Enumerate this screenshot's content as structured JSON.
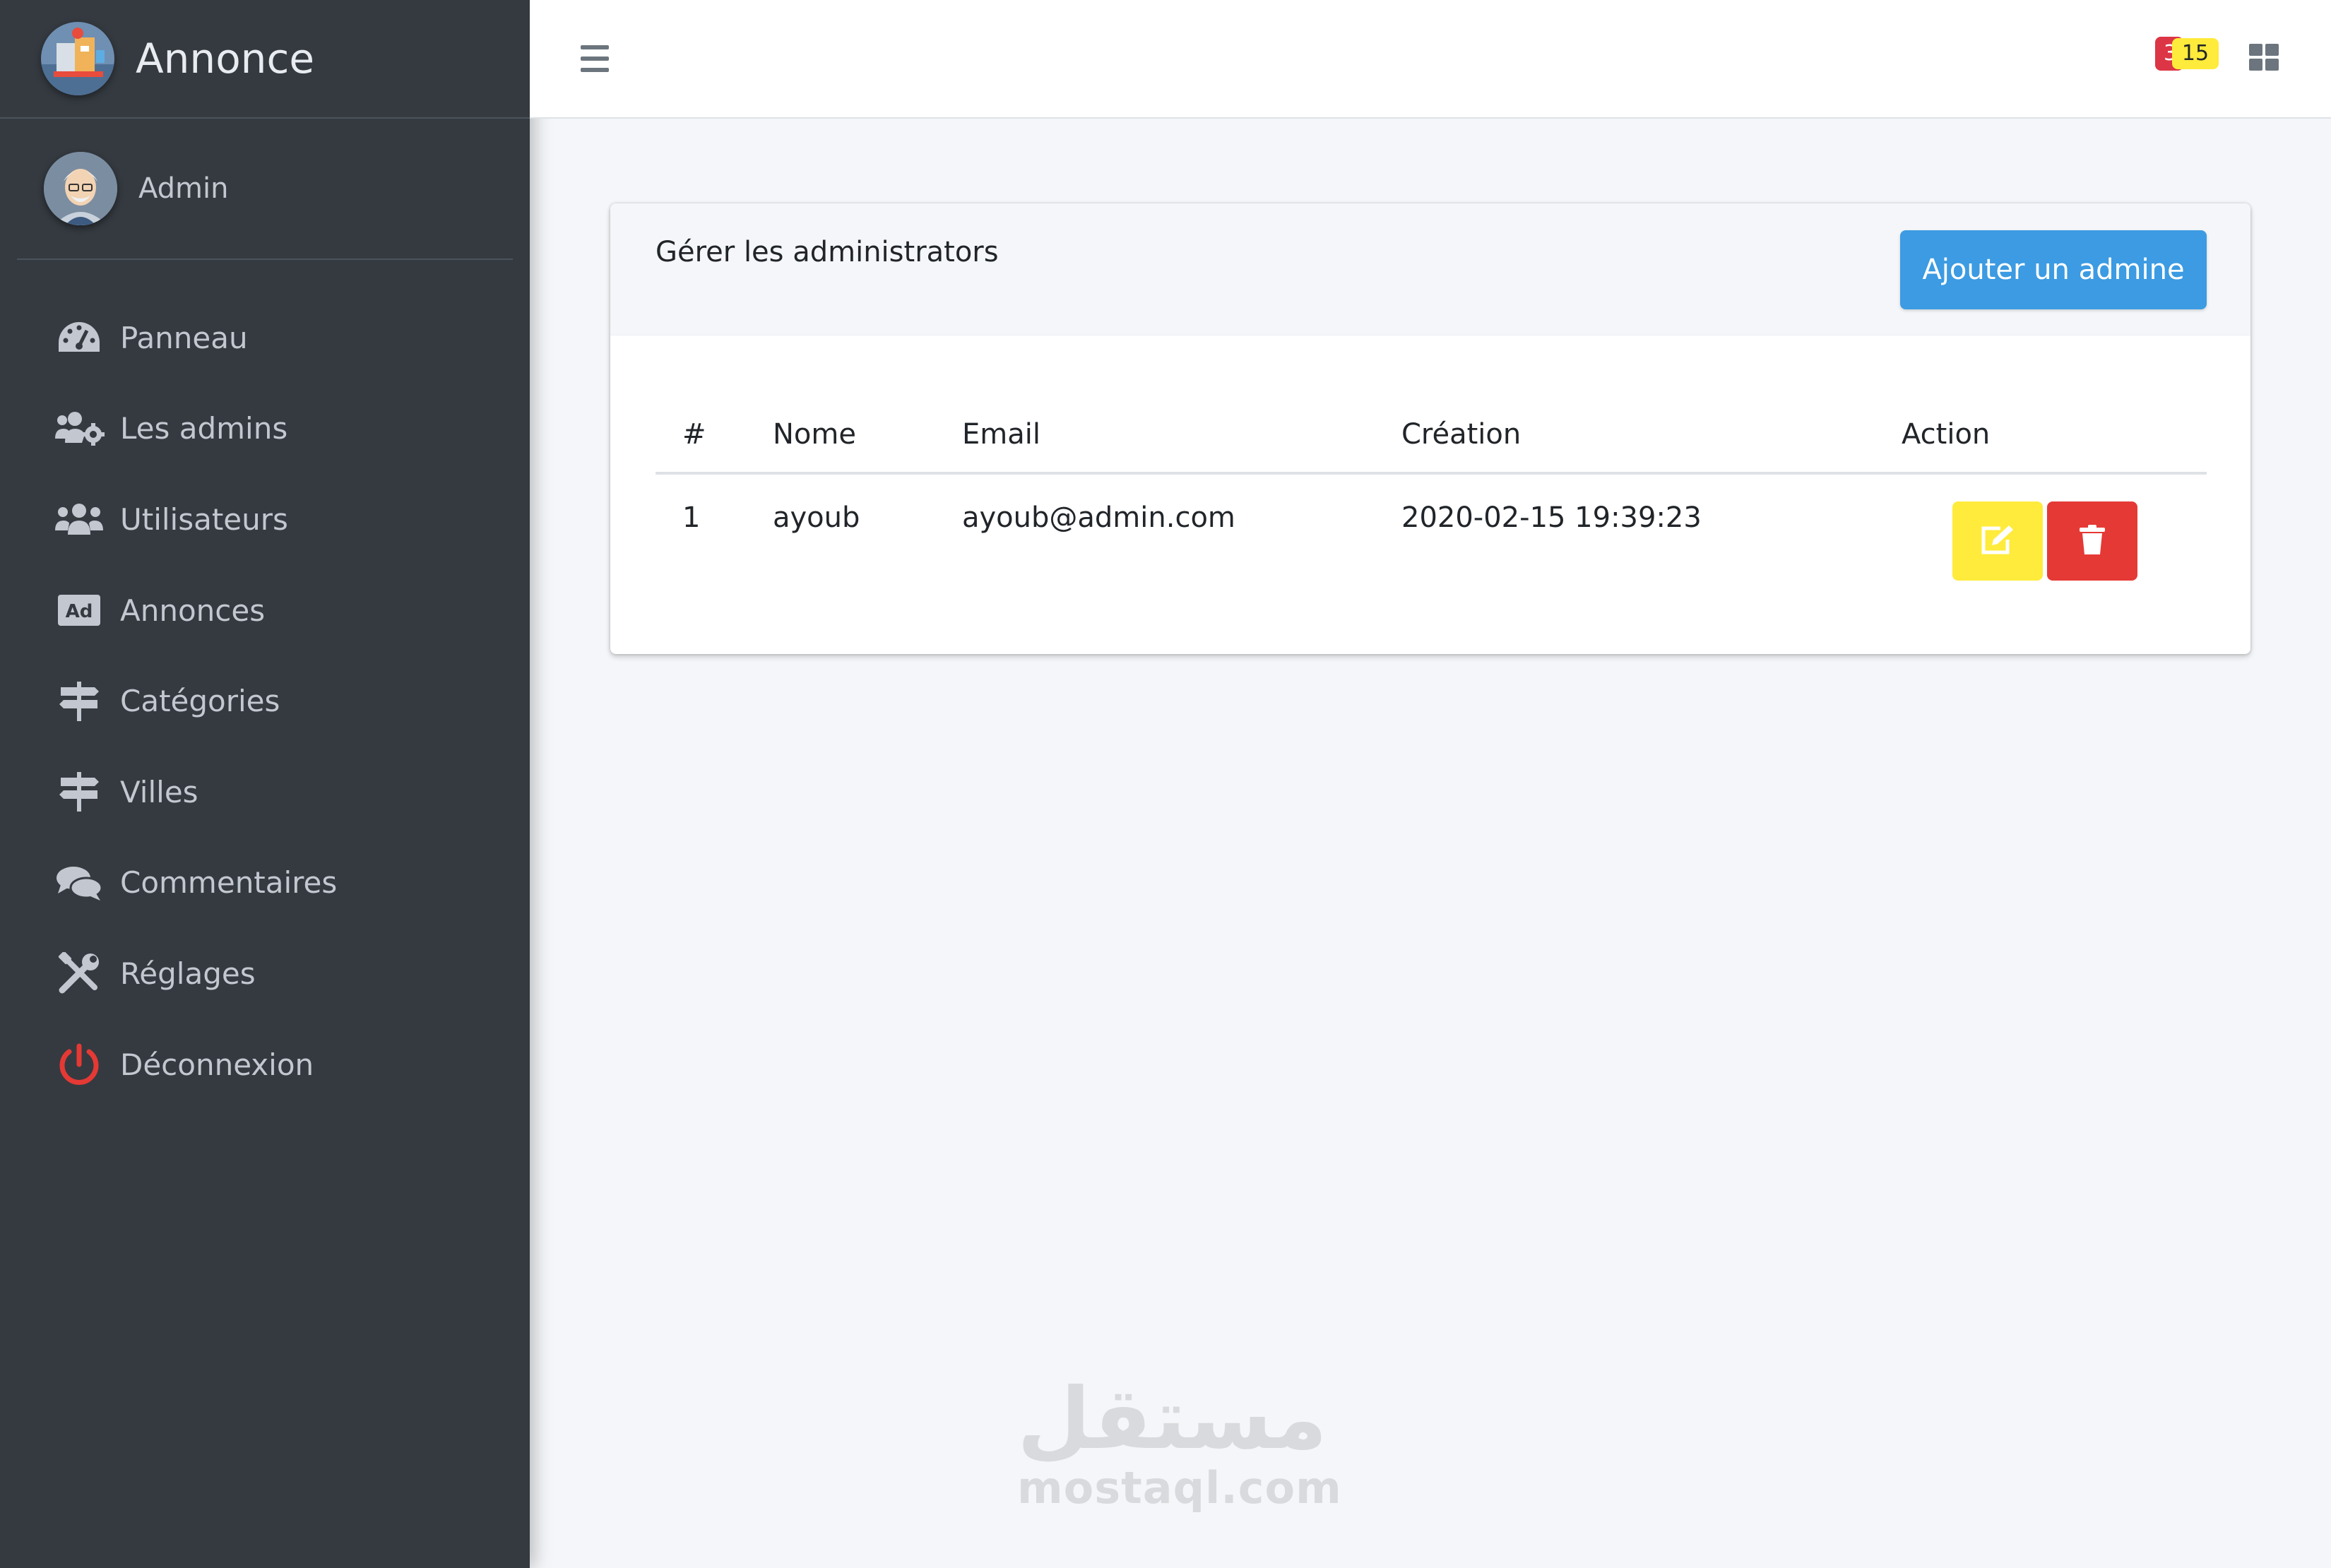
{
  "app": {
    "title": "Annonce"
  },
  "user": {
    "name": "Admin"
  },
  "sidebar": {
    "items": [
      {
        "label": "Panneau",
        "icon": "dashboard-icon"
      },
      {
        "label": "Les admins",
        "icon": "users-cog-icon"
      },
      {
        "label": "Utilisateurs",
        "icon": "users-icon"
      },
      {
        "label": "Annonces",
        "icon": "ad-icon"
      },
      {
        "label": "Catégories",
        "icon": "signpost-icon"
      },
      {
        "label": "Villes",
        "icon": "signpost-icon"
      },
      {
        "label": "Commentaires",
        "icon": "comments-icon"
      },
      {
        "label": "Réglages",
        "icon": "tools-icon"
      },
      {
        "label": "Déconnexion",
        "icon": "power-icon"
      }
    ]
  },
  "topbar": {
    "badge_red": "3",
    "badge_yellow": "15"
  },
  "card": {
    "title": "Gérer les administrators",
    "add_button": "Ajouter un admine",
    "columns": [
      "#",
      "Nome",
      "Email",
      "Création",
      "Action"
    ],
    "rows": [
      {
        "id": "1",
        "name": "ayoub",
        "email": "ayoub@admin.com",
        "created": "2020-02-15 19:39:23"
      }
    ]
  },
  "watermark": {
    "arabic": "مستقل",
    "latin": "mostaql.com"
  },
  "colors": {
    "sidebar_bg": "#343a40",
    "primary": "#3c9be2",
    "warning": "#ffeb3b",
    "danger": "#e53935",
    "content_bg": "#f4f6f9"
  }
}
